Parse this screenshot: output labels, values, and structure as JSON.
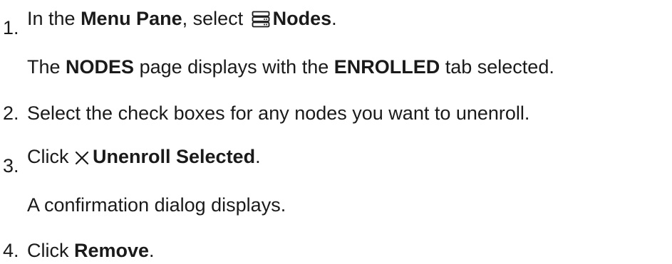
{
  "steps": [
    {
      "number": "1.",
      "parts": {
        "t1": "In the ",
        "b1": "Menu Pane",
        "t2": ", select ",
        "icon": "server-stack-icon",
        "b2": "Nodes",
        "t3": "."
      },
      "result": {
        "t1": "The ",
        "b1": "NODES",
        "t2": " page displays with the ",
        "b2": "ENROLLED",
        "t3": " tab selected."
      }
    },
    {
      "number": "2.",
      "text": "Select the check boxes for any nodes you want to unenroll."
    },
    {
      "number": "3.",
      "parts": {
        "t1": "Click ",
        "icon": "close-x-icon",
        "b1": "Unenroll Selected",
        "t2": "."
      },
      "result": "A confirmation dialog displays."
    },
    {
      "number": "4.",
      "parts": {
        "t1": "Click ",
        "b1": "Remove",
        "t2": "."
      }
    }
  ]
}
